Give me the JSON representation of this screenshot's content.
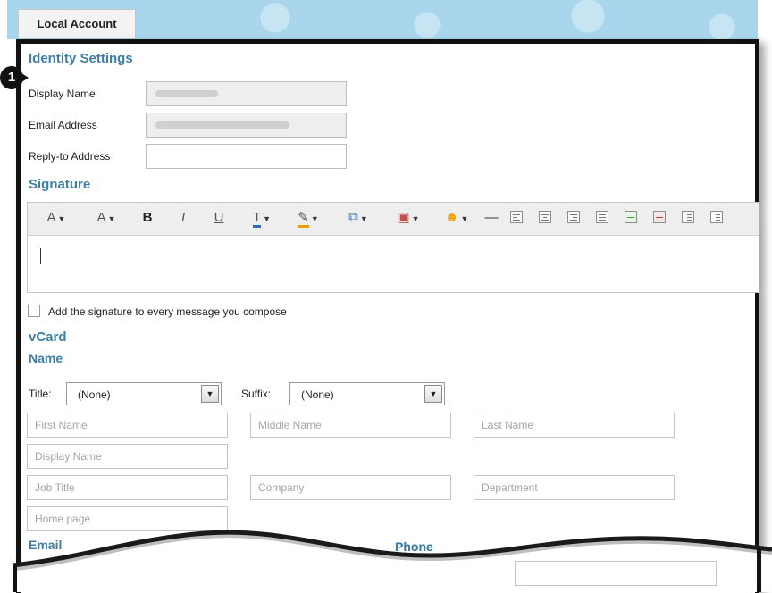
{
  "tab": {
    "label": "Local Account"
  },
  "identity": {
    "title": "Identity Settings",
    "display_name_label": "Display Name",
    "email_label": "Email Address",
    "reply_to_label": "Reply-to Address"
  },
  "callout": {
    "number": "1"
  },
  "signature": {
    "title": "Signature",
    "checkbox_label": "Add the signature to every message you compose"
  },
  "vcard": {
    "title": "vCard",
    "name_title": "Name",
    "title_label": "Title:",
    "title_value": "(None)",
    "suffix_label": "Suffix:",
    "suffix_value": "(None)",
    "placeholders": {
      "first_name": "First Name",
      "middle_name": "Middle Name",
      "last_name": "Last Name",
      "display_name": "Display Name",
      "job_title": "Job Title",
      "company": "Company",
      "department": "Department",
      "home_page": "Home page"
    },
    "email_title": "Email",
    "phone_title": "Phone"
  },
  "icons": {
    "font": "font-icon",
    "font_size": "font-size-icon",
    "bold": "bold-icon",
    "italic": "italic-icon",
    "underline": "underline-icon",
    "text_color": "text-color-icon",
    "highlight": "highlight-icon",
    "link": "link-icon",
    "image": "image-icon",
    "emoticon": "emoticon-icon",
    "horizontal_rule": "horizontal-rule-icon"
  },
  "colors": {
    "accent": "#3f7fa6",
    "banner": "#a9d6ec"
  }
}
